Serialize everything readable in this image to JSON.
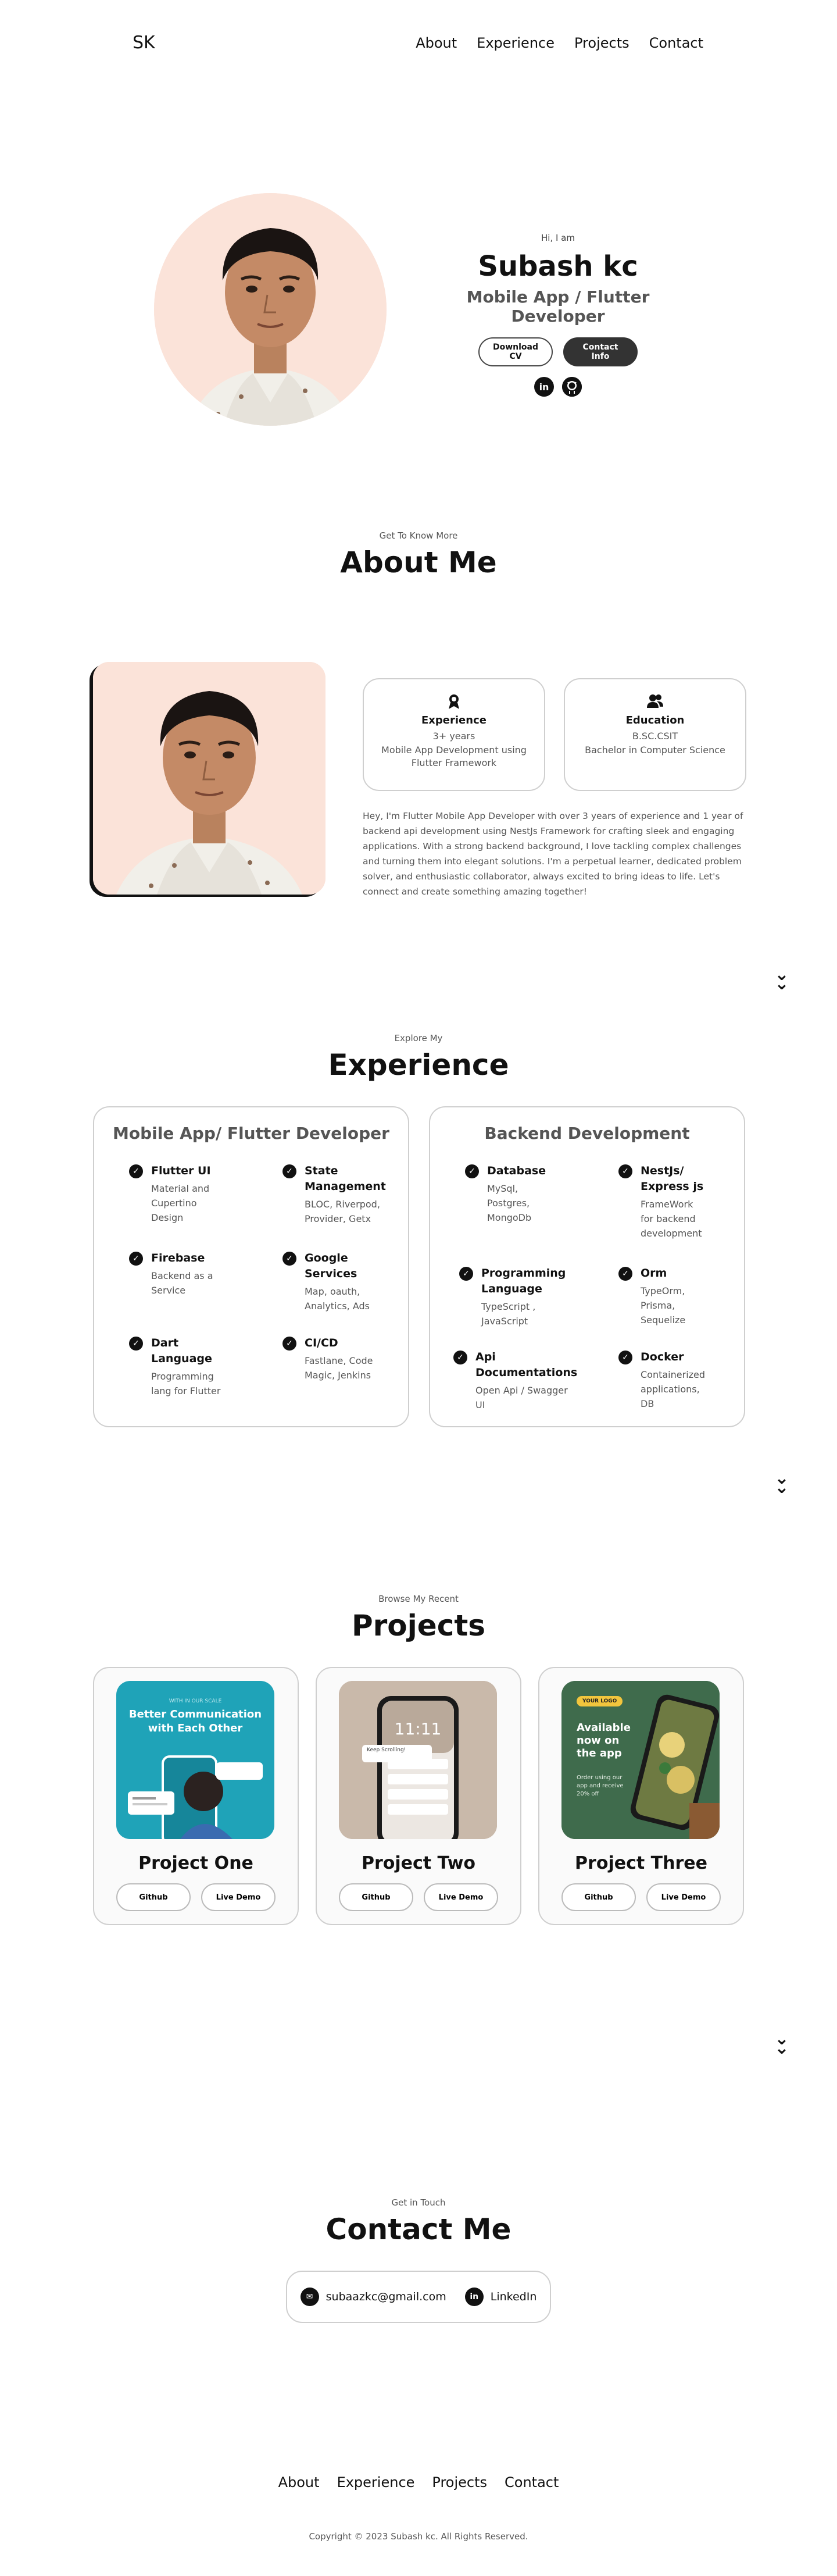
{
  "nav": {
    "logo": "SK",
    "links": [
      "About",
      "Experience",
      "Projects",
      "Contact"
    ]
  },
  "hero": {
    "greeting": "Hi, I am",
    "name": "Subash kc",
    "title": "Mobile App / Flutter Developer",
    "download_cv": "Download CV",
    "contact_info": "Contact Info",
    "social": [
      "linkedin-icon",
      "github-icon"
    ]
  },
  "about": {
    "subtitle": "Get To Know More",
    "title": "About Me",
    "experience_card": {
      "title": "Experience",
      "line1": "3+ years",
      "line2": "Mobile App Development using Flutter Framework"
    },
    "education_card": {
      "title": "Education",
      "line1": "B.SC.CSIT",
      "line2": "Bachelor in Computer Science"
    },
    "paragraph": "Hey, I'm Flutter Mobile App Developer with over 3 years of experience and 1 year of backend api development using NestJs Framework for crafting sleek and engaging applications. With a strong backend background, I love tackling complex challenges and turning them into elegant solutions. I'm a perpetual learner, dedicated problem solver, and enthusiastic collaborator, always excited to bring ideas to life. Let's connect and create something amazing together!"
  },
  "experience": {
    "subtitle": "Explore My",
    "title": "Experience",
    "cards": [
      {
        "title": "Mobile App/ Flutter Developer",
        "skills": [
          {
            "name": "Flutter UI",
            "level": "Material and Cupertino Design"
          },
          {
            "name": "State Management",
            "level": "BLOC, Riverpod, Provider, Getx"
          },
          {
            "name": "Firebase",
            "level": "Backend as a Service"
          },
          {
            "name": "Google Services",
            "level": "Map, oauth, Analytics, Ads"
          },
          {
            "name": "Dart Language",
            "level": "Programming lang for Flutter"
          },
          {
            "name": "CI/CD",
            "level": "Fastlane, Code Magic, Jenkins"
          }
        ]
      },
      {
        "title": "Backend Development",
        "skills": [
          {
            "name": "Database",
            "level": "MySql, Postgres, MongoDb"
          },
          {
            "name": "NestJs/ Express js",
            "level": "FrameWork for backend development"
          },
          {
            "name": "Programming Language",
            "level": "TypeScript , JavaScript"
          },
          {
            "name": "Orm",
            "level": "TypeOrm, Prisma, Sequelize"
          },
          {
            "name": "Api Documentations",
            "level": "Open Api / Swagger UI"
          },
          {
            "name": "Docker",
            "level": "Containerized applications, DB"
          }
        ]
      }
    ]
  },
  "projects": {
    "subtitle": "Browse My Recent",
    "title": "Projects",
    "items": [
      {
        "name": "Project One",
        "github": "Github",
        "demo": "Live Demo",
        "image_heading": "Better Communication with Each Other",
        "image_caption": "WITH IN OUR SCALE"
      },
      {
        "name": "Project Two",
        "github": "Github",
        "demo": "Live Demo",
        "image_time": "11:11",
        "image_note": "Keep Scrolling!"
      },
      {
        "name": "Project Three",
        "github": "Github",
        "demo": "Live Demo",
        "image_badge": "YOUR LOGO",
        "image_heading": "Available now on the app",
        "image_caption": "Order using our app and receive 20% off"
      }
    ]
  },
  "contact": {
    "subtitle": "Get in Touch",
    "title": "Contact Me",
    "email": "subaazkc@gmail.com",
    "linkedin": "LinkedIn"
  },
  "footer": {
    "links": [
      "About",
      "Experience",
      "Projects",
      "Contact"
    ],
    "copyright": "Copyright © 2023 Subash kc. All Rights Reserved."
  }
}
